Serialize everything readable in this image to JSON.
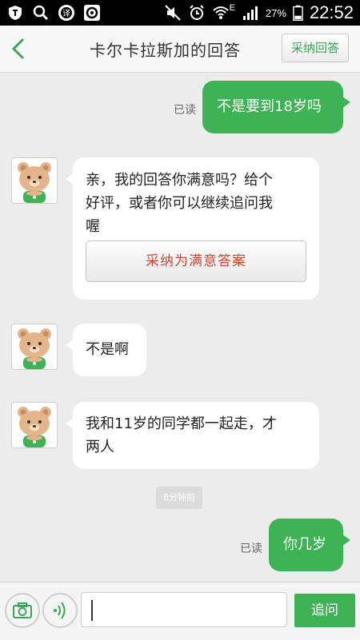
{
  "status_bar": {
    "battery_percent": "27%",
    "time": "22:52",
    "network_type": "E",
    "icons": [
      "shield-app-icon",
      "search-app-icon",
      "translate-app-icon",
      "browser-app-icon",
      "mute-icon",
      "alarm-icon",
      "wifi-icon",
      "signal-icon",
      "battery-icon"
    ]
  },
  "header": {
    "title": "卡尔卡拉斯加的回答",
    "accept_button": "采纳回答",
    "back_icon": "chevron-left-icon",
    "accent_color": "#3db356"
  },
  "messages": [
    {
      "side": "out",
      "read_label": "已读",
      "lines": [
        "不是要到18岁吗"
      ]
    },
    {
      "side": "in",
      "lines": [
        "亲，我的回答你满意吗？给个",
        "好评，或者你可以继续追问我",
        "喔"
      ],
      "button": "采纳为满意答案"
    },
    {
      "side": "in",
      "lines": [
        "不是啊"
      ]
    },
    {
      "side": "in",
      "lines": [
        "我和11岁的同学都一起走，才",
        "两人"
      ]
    },
    {
      "side": "out",
      "read_label": "已读",
      "lines": [
        "你几岁"
      ]
    }
  ],
  "timestamp": "8分钟前",
  "input_bar": {
    "camera_icon": "camera-icon",
    "voice_icon": "voice-icon",
    "input_value": "",
    "send_button": "追问"
  }
}
